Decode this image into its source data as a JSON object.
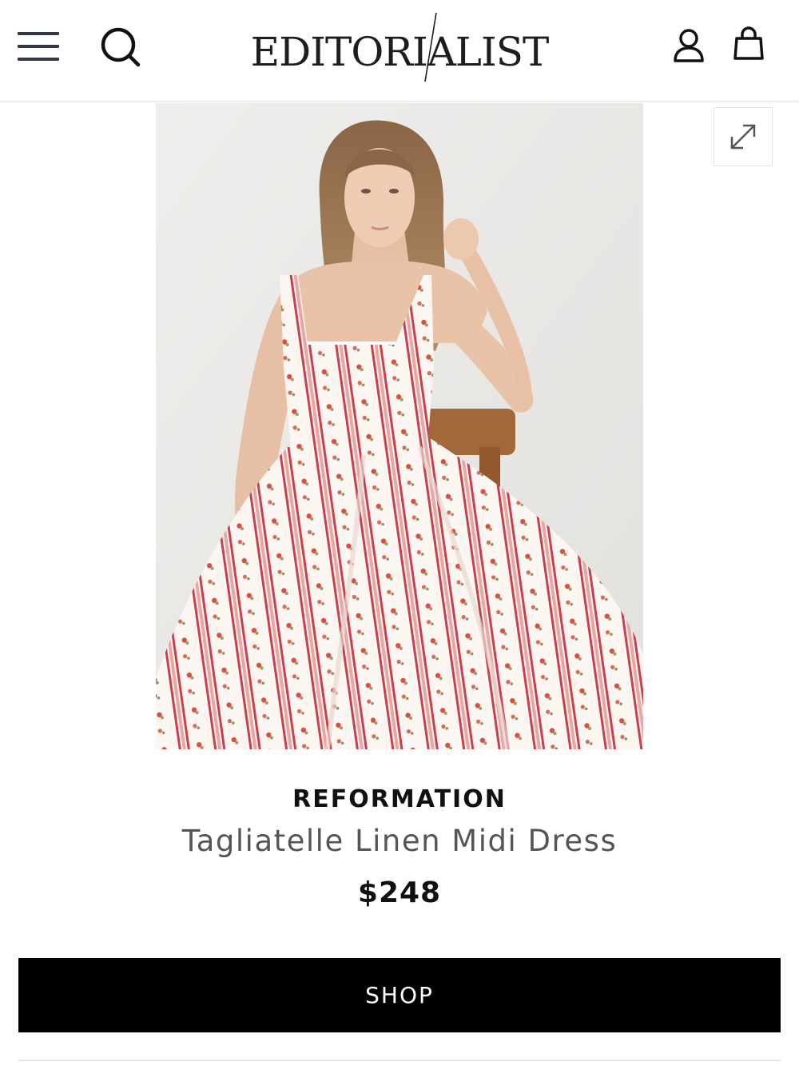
{
  "header": {
    "logo_text": "EDITORIALIST",
    "menu_icon": "hamburger-menu-icon",
    "search_icon": "search-icon",
    "account_icon": "user-icon",
    "bag_icon": "shopping-bag-icon"
  },
  "product": {
    "image_icon": "product-photo",
    "expand_icon": "expand-icon",
    "brand": "REFORMATION",
    "name": "Tagliatelle Linen Midi Dress",
    "price": "$248",
    "shop_label": "SHOP"
  },
  "colors": {
    "accent": "#000000",
    "menu_icon": "#2f3a46",
    "dress_stripe": "#c8414a",
    "dress_base": "#fbf6f2"
  }
}
